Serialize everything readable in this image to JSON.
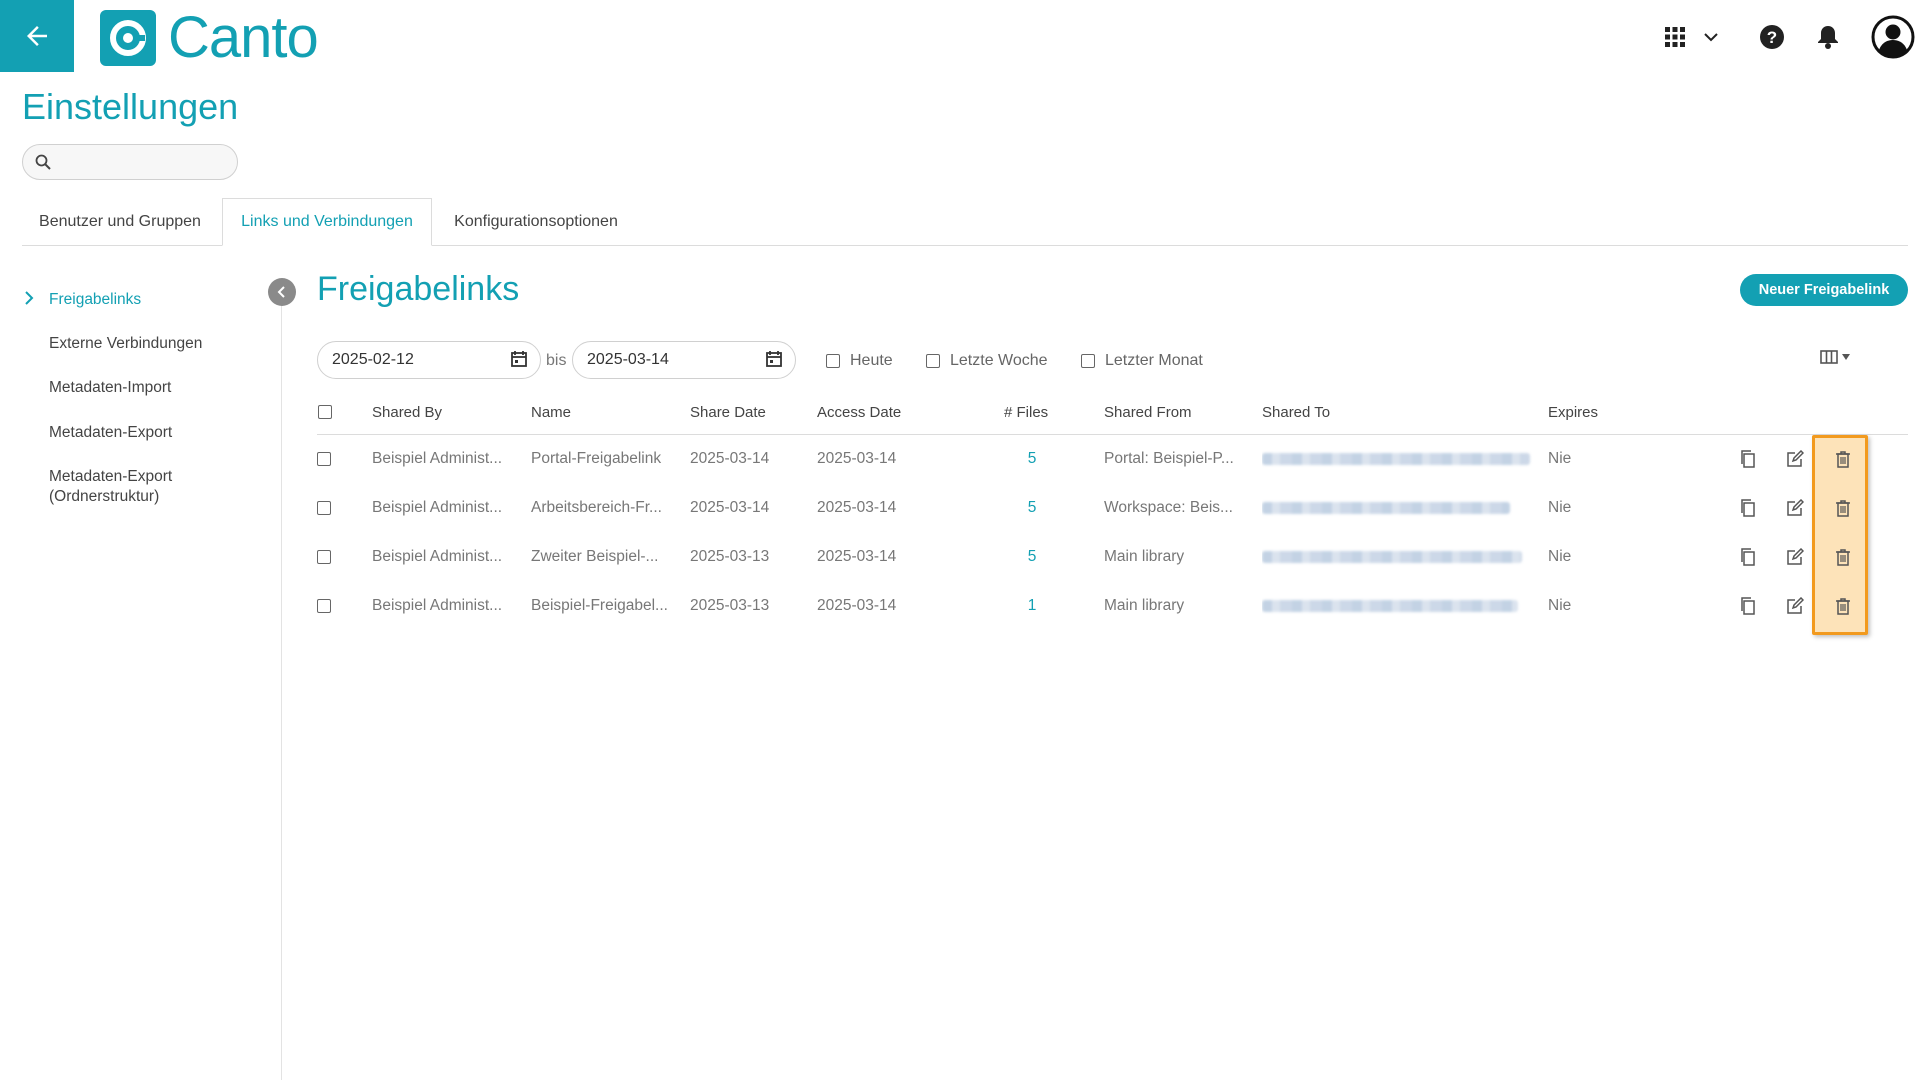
{
  "header": {
    "logo_text": "Canto",
    "icons": [
      "back-arrow-icon",
      "apps-grid-icon",
      "chevron-down-icon",
      "help-icon",
      "bell-icon",
      "user-avatar-icon"
    ]
  },
  "page": {
    "title": "Einstellungen",
    "search_placeholder": ""
  },
  "tabs": [
    {
      "label": "Benutzer und Gruppen",
      "active": false
    },
    {
      "label": "Links und Verbindungen",
      "active": true
    },
    {
      "label": "Konfigurationsoptionen",
      "active": false
    }
  ],
  "sidebar": {
    "items": [
      {
        "label": "Freigabelinks",
        "active": true
      },
      {
        "label": "Externe Verbindungen",
        "active": false
      },
      {
        "label": "Metadaten-Import",
        "active": false
      },
      {
        "label": "Metadaten-Export",
        "active": false
      },
      {
        "label": "Metadaten-Export\n(Ordnerstruktur)",
        "active": false
      }
    ]
  },
  "main": {
    "title": "Freigabelinks",
    "new_button": "Neuer Freigabelink",
    "filters": {
      "date_from": "2025-02-12",
      "separator": "bis",
      "date_to": "2025-03-14",
      "checkboxes": [
        "Heute",
        "Letzte Woche",
        "Letzter Monat"
      ]
    },
    "columns": [
      "Shared By",
      "Name",
      "Share Date",
      "Access Date",
      "# Files",
      "Shared From",
      "Shared To",
      "Expires"
    ],
    "rows": [
      {
        "shared_by": "Beispiel Administ...",
        "name": "Portal-Freigabelink",
        "share_date": "2025-03-14",
        "access_date": "2025-03-14",
        "files": "5",
        "shared_from": "Portal: Beispiel-P...",
        "expires": "Nie"
      },
      {
        "shared_by": "Beispiel Administ...",
        "name": "Arbeitsbereich-Fr...",
        "share_date": "2025-03-14",
        "access_date": "2025-03-14",
        "files": "5",
        "shared_from": "Workspace: Beis...",
        "expires": "Nie"
      },
      {
        "shared_by": "Beispiel Administ...",
        "name": "Zweiter Beispiel-...",
        "share_date": "2025-03-13",
        "access_date": "2025-03-14",
        "files": "5",
        "shared_from": "Main library",
        "expires": "Nie"
      },
      {
        "shared_by": "Beispiel Administ...",
        "name": "Beispiel-Freigabel...",
        "share_date": "2025-03-13",
        "access_date": "2025-03-14",
        "files": "1",
        "shared_from": "Main library",
        "expires": "Nie"
      }
    ],
    "row_action_icons": [
      "copy-icon",
      "edit-icon",
      "trash-icon"
    ]
  },
  "colors": {
    "accent": "#13a0b3",
    "highlight_fill": "#fde3b9",
    "highlight_border": "#f29a1e"
  }
}
